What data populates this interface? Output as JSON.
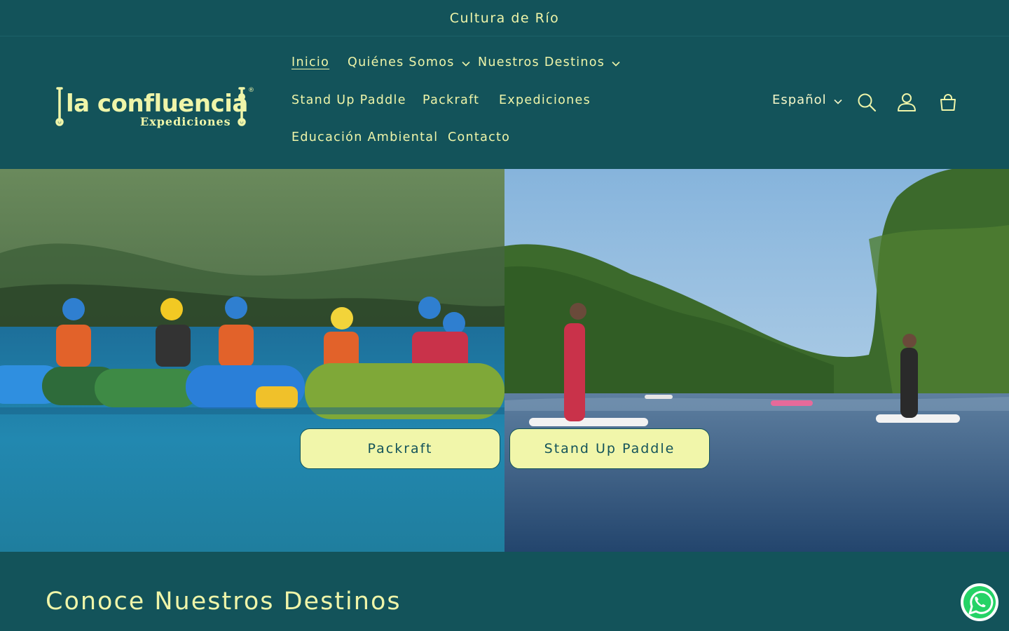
{
  "announcement": {
    "text": "Cultura de Río"
  },
  "logo": {
    "wordmark": "la confluencia",
    "subtitle": "Expediciones",
    "registered": "®"
  },
  "nav": {
    "items": [
      {
        "label": "Inicio",
        "active": true,
        "has_dropdown": false
      },
      {
        "label": "Quiénes Somos",
        "active": false,
        "has_dropdown": true
      },
      {
        "label": "Nuestros Destinos",
        "active": false,
        "has_dropdown": true
      },
      {
        "label": "Stand Up Paddle",
        "active": false,
        "has_dropdown": false
      },
      {
        "label": "Packraft",
        "active": false,
        "has_dropdown": false
      },
      {
        "label": "Expediciones",
        "active": false,
        "has_dropdown": false
      },
      {
        "label": "Educación Ambiental",
        "active": false,
        "has_dropdown": false
      },
      {
        "label": "Contacto",
        "active": false,
        "has_dropdown": false
      }
    ]
  },
  "header_tools": {
    "language": "Español",
    "icons": [
      "search-icon",
      "account-icon",
      "cart-icon"
    ]
  },
  "hero": {
    "left": {
      "button_label": "Packraft"
    },
    "right": {
      "button_label": "Stand Up Paddle"
    }
  },
  "section": {
    "title": "Conoce Nuestros Destinos"
  },
  "floating": {
    "icon": "whatsapp-icon"
  },
  "colors": {
    "primary_bg": "#13535a",
    "accent_text": "#eff5a9",
    "button_bg": "#f1f6aa",
    "whatsapp_green": "#25d366"
  }
}
